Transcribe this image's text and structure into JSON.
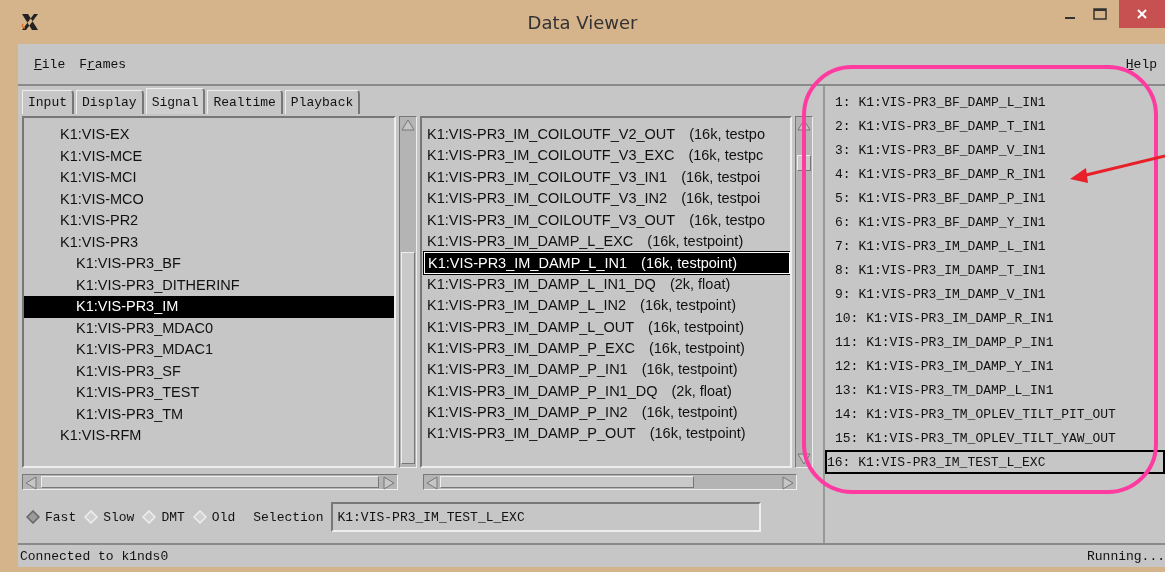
{
  "window": {
    "title": "Data Viewer"
  },
  "menu": [
    {
      "key": "F",
      "after": "ile"
    },
    {
      "before": "F",
      "key": "r",
      "after": "ames"
    }
  ],
  "help_menu": {
    "key": "H",
    "after": "elp"
  },
  "tabs": [
    {
      "label": "Input",
      "selected": false
    },
    {
      "label": "Display",
      "selected": false
    },
    {
      "label": "Signal",
      "selected": true
    },
    {
      "label": "Realtime",
      "selected": false
    },
    {
      "label": "Playback",
      "selected": false
    }
  ],
  "tree": [
    {
      "label": "K1:VIS-EX",
      "selected": false
    },
    {
      "label": "K1:VIS-MCE",
      "selected": false
    },
    {
      "label": "K1:VIS-MCI",
      "selected": false
    },
    {
      "label": "K1:VIS-MCO",
      "selected": false
    },
    {
      "label": "K1:VIS-PR2",
      "selected": false
    },
    {
      "label": "K1:VIS-PR3",
      "selected": false,
      "children": [
        {
          "label": "K1:VIS-PR3_BF",
          "selected": false
        },
        {
          "label": "K1:VIS-PR3_DITHERINF",
          "selected": false
        },
        {
          "label": "K1:VIS-PR3_IM",
          "selected": true
        },
        {
          "label": "K1:VIS-PR3_MDAC0",
          "selected": false
        },
        {
          "label": "K1:VIS-PR3_MDAC1",
          "selected": false
        },
        {
          "label": "K1:VIS-PR3_SF",
          "selected": false
        },
        {
          "label": "K1:VIS-PR3_TEST",
          "selected": false
        },
        {
          "label": "K1:VIS-PR3_TM",
          "selected": false
        }
      ]
    },
    {
      "label": "K1:VIS-RFM",
      "selected": false
    }
  ],
  "channels": [
    {
      "name": "K1:VIS-PR3_IM_COILOUTF_V2_OUT",
      "info": "(16k, testpo",
      "selected": false
    },
    {
      "name": "K1:VIS-PR3_IM_COILOUTF_V3_EXC",
      "info": "(16k, testpc",
      "selected": false
    },
    {
      "name": "K1:VIS-PR3_IM_COILOUTF_V3_IN1",
      "info": "(16k, testpoi",
      "selected": false
    },
    {
      "name": "K1:VIS-PR3_IM_COILOUTF_V3_IN2",
      "info": "(16k, testpoi",
      "selected": false
    },
    {
      "name": "K1:VIS-PR3_IM_COILOUTF_V3_OUT",
      "info": "(16k, testpo",
      "selected": false
    },
    {
      "name": "K1:VIS-PR3_IM_DAMP_L_EXC",
      "info": "(16k, testpoint)",
      "selected": false
    },
    {
      "name": "K1:VIS-PR3_IM_DAMP_L_IN1",
      "info": "(16k, testpoint)",
      "selected": true
    },
    {
      "name": "K1:VIS-PR3_IM_DAMP_L_IN1_DQ",
      "info": "(2k, float)",
      "selected": false
    },
    {
      "name": "K1:VIS-PR3_IM_DAMP_L_IN2",
      "info": "(16k, testpoint)",
      "selected": false
    },
    {
      "name": "K1:VIS-PR3_IM_DAMP_L_OUT",
      "info": "(16k, testpoint)",
      "selected": false
    },
    {
      "name": "K1:VIS-PR3_IM_DAMP_P_EXC",
      "info": "(16k, testpoint)",
      "selected": false
    },
    {
      "name": "K1:VIS-PR3_IM_DAMP_P_IN1",
      "info": "(16k, testpoint)",
      "selected": false
    },
    {
      "name": "K1:VIS-PR3_IM_DAMP_P_IN1_DQ",
      "info": "(2k, float)",
      "selected": false
    },
    {
      "name": "K1:VIS-PR3_IM_DAMP_P_IN2",
      "info": "(16k, testpoint)",
      "selected": false
    },
    {
      "name": "K1:VIS-PR3_IM_DAMP_P_OUT",
      "info": "(16k, testpoint)",
      "selected": false
    }
  ],
  "rates": [
    {
      "label": "Fast",
      "selected": true
    },
    {
      "label": "Slow",
      "selected": false
    },
    {
      "label": "DMT",
      "selected": false
    },
    {
      "label": "Old",
      "selected": false
    }
  ],
  "selection": {
    "label": "Selection",
    "value": "K1:VIS-PR3_IM_TEST_L_EXC"
  },
  "selected_list": [
    {
      "label": "1: K1:VIS-PR3_BF_DAMP_L_IN1",
      "focused": false
    },
    {
      "label": "2: K1:VIS-PR3_BF_DAMP_T_IN1",
      "focused": false
    },
    {
      "label": "3: K1:VIS-PR3_BF_DAMP_V_IN1",
      "focused": false
    },
    {
      "label": "4: K1:VIS-PR3_BF_DAMP_R_IN1",
      "focused": false
    },
    {
      "label": "5: K1:VIS-PR3_BF_DAMP_P_IN1",
      "focused": false
    },
    {
      "label": "6: K1:VIS-PR3_BF_DAMP_Y_IN1",
      "focused": false
    },
    {
      "label": "7: K1:VIS-PR3_IM_DAMP_L_IN1",
      "focused": false
    },
    {
      "label": "8: K1:VIS-PR3_IM_DAMP_T_IN1",
      "focused": false
    },
    {
      "label": "9: K1:VIS-PR3_IM_DAMP_V_IN1",
      "focused": false
    },
    {
      "label": "10: K1:VIS-PR3_IM_DAMP_R_IN1",
      "focused": false
    },
    {
      "label": "11: K1:VIS-PR3_IM_DAMP_P_IN1",
      "focused": false
    },
    {
      "label": "12: K1:VIS-PR3_IM_DAMP_Y_IN1",
      "focused": false
    },
    {
      "label": "13: K1:VIS-PR3_TM_DAMP_L_IN1",
      "focused": false
    },
    {
      "label": "14: K1:VIS-PR3_TM_OPLEV_TILT_PIT_OUT",
      "focused": false
    },
    {
      "label": "15: K1:VIS-PR3_TM_OPLEV_TILT_YAW_OUT",
      "focused": false
    },
    {
      "label": "16: K1:VIS-PR3_IM_TEST_L_EXC",
      "focused": true
    }
  ],
  "status_bar": {
    "left": "Connected to k1nds0",
    "right": "Running..."
  }
}
